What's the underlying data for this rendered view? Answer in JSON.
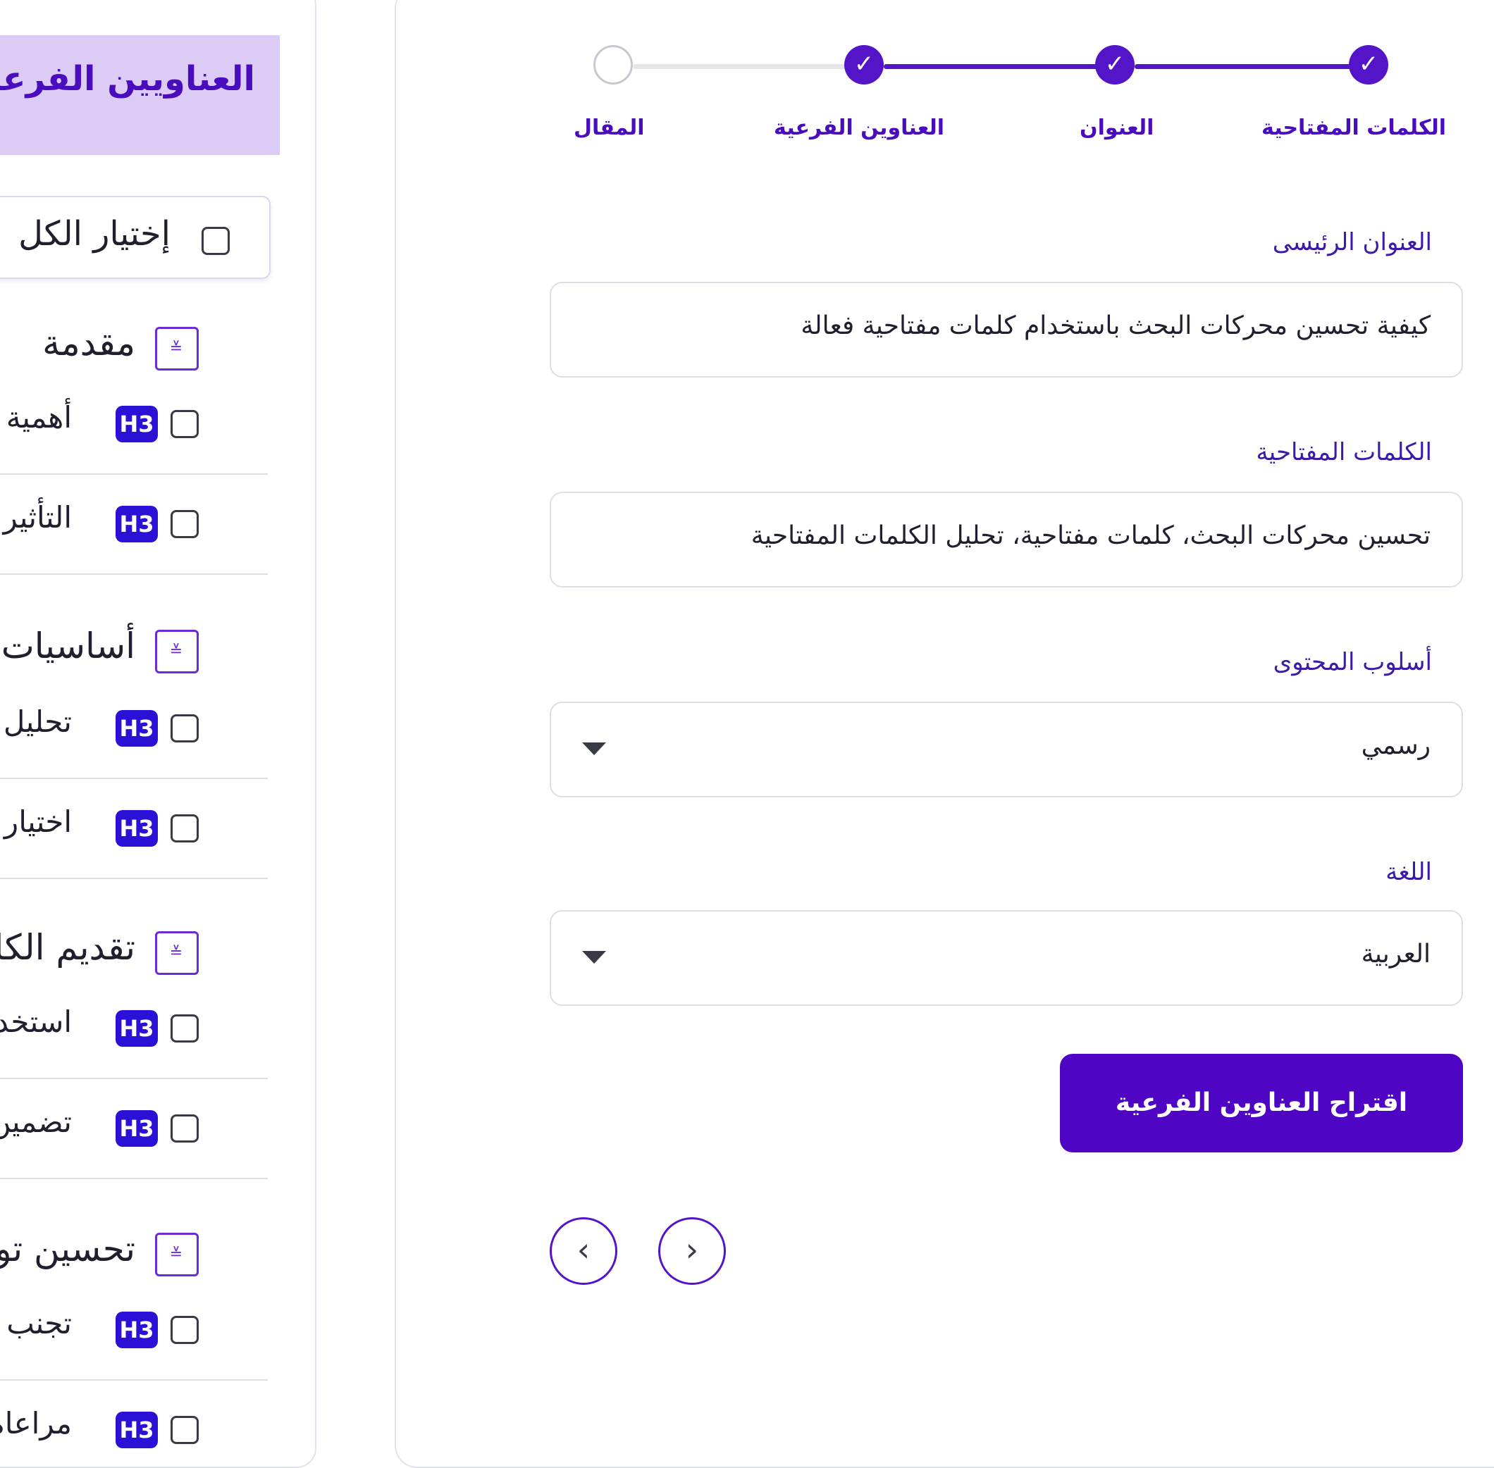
{
  "sidebar": {
    "title": "العناويين الفرعية",
    "select_all_label": "إختيار الكل",
    "sections": [
      {
        "title": "مقدمة",
        "items": [
          "أهمية تحسين محركات البحث",
          "التأثير المباشر للكلمات المفتاحية"
        ]
      },
      {
        "title": "أساسيات الكلمات المفتاحية",
        "items": [
          "تحليل الكلمات المفتاحية",
          "اختيار كلمات مفتاحية فعالة"
        ]
      },
      {
        "title": "تقديم الكلمات المفتاحية",
        "items": [
          "استخدام الكلمات في العناوين",
          "تضمين الكلمات في المحتوى"
        ]
      },
      {
        "title": "تحسين توزيع الكلمات",
        "items": [
          "تجنب الحشو الزائد",
          "مراعاة كثافة الكلمات"
        ]
      }
    ],
    "badge_label": "H3"
  },
  "stepper": {
    "steps": [
      {
        "label": "الكلمات المفتاحية",
        "status": "done"
      },
      {
        "label": "العنوان",
        "status": "done"
      },
      {
        "label": "العناوين الفرعية",
        "status": "done"
      },
      {
        "label": "المقال",
        "status": "pending"
      }
    ],
    "check_glyph": "✓"
  },
  "form": {
    "main_title_label": "العنوان الرئيسى",
    "main_title_value": "كيفية تحسين محركات البحث باستخدام كلمات مفتاحية فعالة",
    "keywords_label": "الكلمات المفتاحية",
    "keywords_value": "تحسين محركات البحث، كلمات مفتاحية، تحليل الكلمات المفتاحية",
    "style_label": "أسلوب المحتوى",
    "style_value": "رسمي",
    "language_label": "اللغة",
    "language_value": "العربية",
    "submit_label": "اقتراح العناوين الفرعية"
  },
  "nav": {
    "prev_glyph": "‹",
    "next_glyph": "›"
  },
  "colors": {
    "accent": "#5414c8",
    "badge": "#2b10d6",
    "header_bg": "#dccbf5",
    "label": "#3b1aa8"
  }
}
